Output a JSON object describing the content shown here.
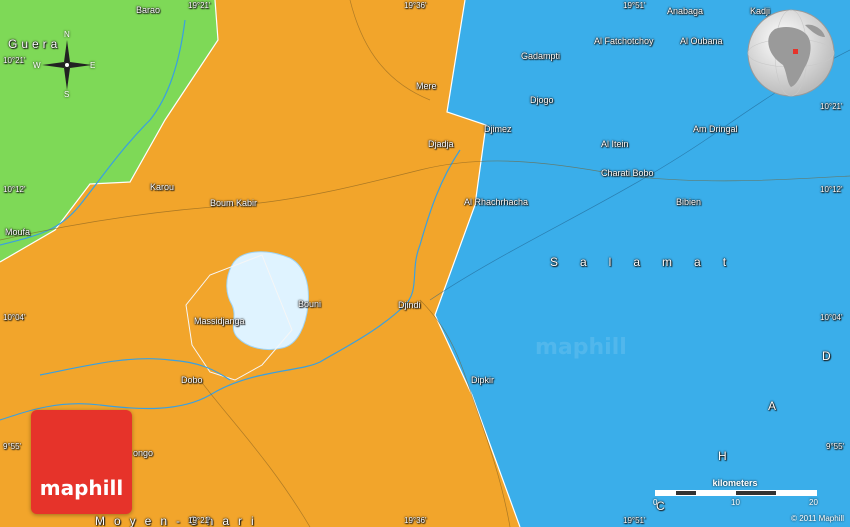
{
  "regions": {
    "gunera": "Guera",
    "salamat": "Salamat",
    "chad_vertical": [
      "C",
      "H",
      "A",
      "D"
    ],
    "moyen_chari": "Moyen-Chari"
  },
  "places": [
    {
      "key": "barao",
      "name": "Barao"
    },
    {
      "key": "mere",
      "name": "Mere"
    },
    {
      "key": "karou",
      "name": "Karou"
    },
    {
      "key": "boum_kabir",
      "name": "Boum Kabir"
    },
    {
      "key": "moufa",
      "name": "Moufa"
    },
    {
      "key": "djadja",
      "name": "Djadja"
    },
    {
      "key": "djimez",
      "name": "Djimez"
    },
    {
      "key": "bouni",
      "name": "Bouni"
    },
    {
      "key": "massidjanga",
      "name": "Massidjanga"
    },
    {
      "key": "djindi",
      "name": "Djindi"
    },
    {
      "key": "dobo",
      "name": "Dobo"
    },
    {
      "key": "dipkir",
      "name": "Dipkir"
    },
    {
      "key": "ongo",
      "name": "ongo"
    },
    {
      "key": "anabaga",
      "name": "Anabaga"
    },
    {
      "key": "kadji",
      "name": "Kadji"
    },
    {
      "key": "al_fatchotchoy",
      "name": "Al Fatchotchoy"
    },
    {
      "key": "al_oubana",
      "name": "Al Oubana"
    },
    {
      "key": "gadampti",
      "name": "Gadampti"
    },
    {
      "key": "djogo",
      "name": "Djogo"
    },
    {
      "key": "am_dringal",
      "name": "Am Dringal"
    },
    {
      "key": "al_itein",
      "name": "Al Itein"
    },
    {
      "key": "charati_bobo",
      "name": "Charati Bobo"
    },
    {
      "key": "al_rhachrhacha",
      "name": "Al Rhachrhacha"
    },
    {
      "key": "bibien",
      "name": "Bibien"
    }
  ],
  "coordinates": {
    "top": [
      "19°21'",
      "19°36'",
      "19°51'"
    ],
    "bottom": [
      "19°21'",
      "19°36'",
      "19°51'"
    ],
    "left": [
      "10°21'",
      "10°12'",
      "10°04'",
      "9°55'"
    ],
    "right": [
      "10°21'",
      "10°12'",
      "10°04'",
      "9°55'"
    ]
  },
  "compass": {
    "n": "N",
    "s": "S",
    "e": "E",
    "w": "W"
  },
  "brand": "maphill",
  "watermark": "maphill",
  "scale": {
    "title": "kilometers",
    "ticks": [
      "0",
      "10",
      "20"
    ]
  },
  "copyright": "© 2011 Maphill",
  "colors": {
    "guera": "#7ed957",
    "orange": "#f2a52b",
    "salamat": "#3aaeea",
    "lake": "#dff3ff",
    "river": "#3aa0e0",
    "brand": "#e6332a"
  }
}
